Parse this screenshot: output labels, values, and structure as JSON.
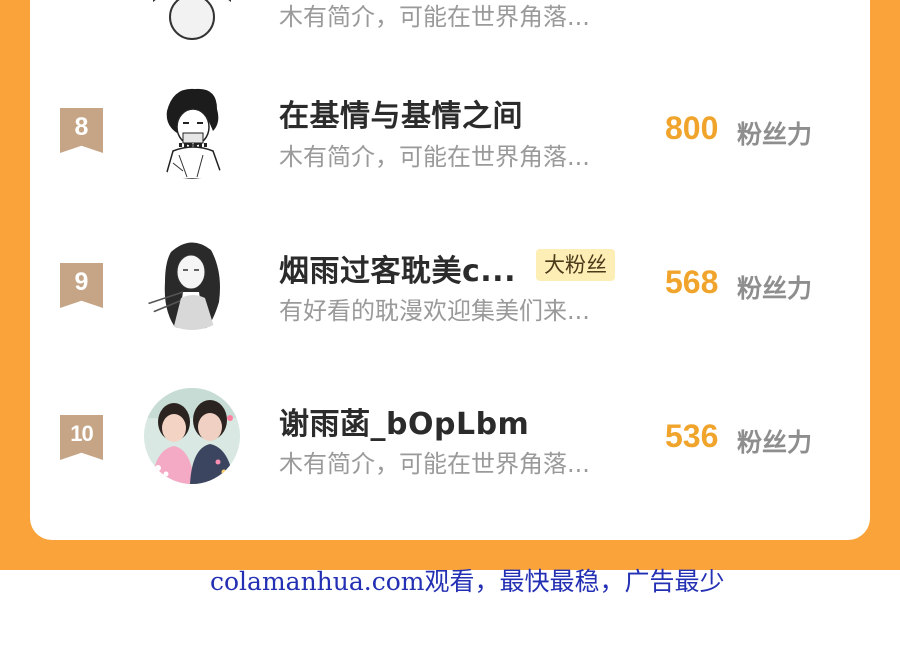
{
  "ranking": {
    "top_partial": {
      "bio": "木有简介，可能在世界角落..."
    },
    "rows": [
      {
        "rank": "8",
        "name": "在基情与基情之间",
        "bio": "木有简介，可能在世界角落...",
        "fans": "800",
        "fans_unit": "粉丝力",
        "avatar": "sketch-boy-avatar"
      },
      {
        "rank": "9",
        "name": "烟雨过客耽美c...",
        "tag": "大粉丝",
        "bio": "有好看的耽漫欢迎集美们来...",
        "fans": "568",
        "fans_unit": "粉丝力",
        "avatar": "longhair-sketch-avatar"
      },
      {
        "rank": "10",
        "name": "谢雨菡_bOpLbm",
        "bio": "木有简介，可能在世界角落...",
        "fans": "536",
        "fans_unit": "粉丝力",
        "avatar": "photo-two-girls-avatar"
      }
    ]
  },
  "footer": {
    "text": "colamanhua.com观看，最快最稳，广告最少"
  },
  "colors": {
    "frame_orange": "#f9a33a",
    "badge_tan": "#c5a586",
    "score_gold": "#f0a42b",
    "tag_yellow": "#fdeeb6",
    "footer_blue": "#2430b4"
  }
}
